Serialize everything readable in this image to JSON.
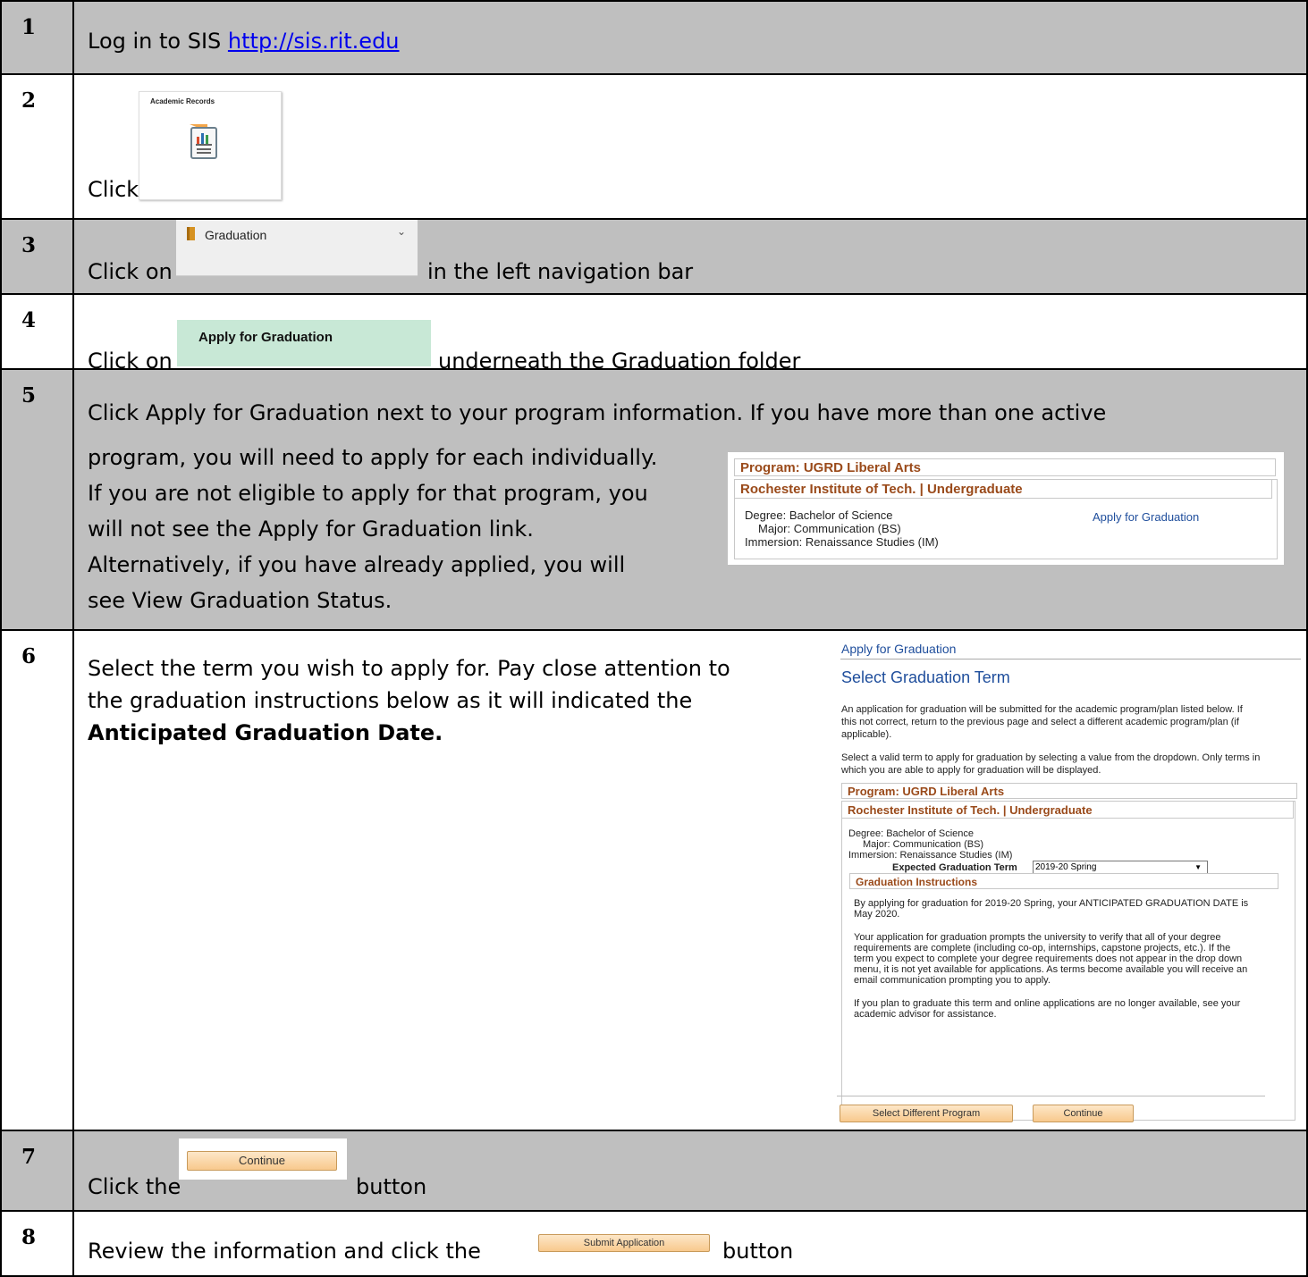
{
  "steps": {
    "s1": {
      "num": "1",
      "prefix": "Log in to SIS ",
      "link": "http://sis.rit.edu"
    },
    "s2": {
      "num": "2",
      "click": "Click",
      "tile_title": "Academic Records",
      "tile_icon": "report-chart-icon"
    },
    "s3": {
      "num": "3",
      "pre": "Click on",
      "nav_label": "Graduation",
      "post": "in the left navigation bar"
    },
    "s4": {
      "num": "4",
      "pre": "Click on",
      "button": "Apply for Graduation",
      "post": "underneath the Graduation folder"
    },
    "s5": {
      "num": "5",
      "line1": "Click Apply for Graduation next to your program information. If you have more than one active",
      "line2": "program, you will need to apply for each individually.",
      "line3": "If you are not eligible to apply for that program, you",
      "line4": "will not see the Apply for Graduation link.",
      "line5": "Alternatively, if you have already applied, you will",
      "line6": "see View Graduation Status.",
      "program": "Program: UGRD Liberal Arts",
      "institution": "Rochester Institute of Tech. | Undergraduate",
      "degree": "Degree: Bachelor of Science",
      "major": "Major: Communication (BS)",
      "immersion": "Immersion: Renaissance Studies (IM)",
      "apply_link": "Apply for Graduation"
    },
    "s6": {
      "num": "6",
      "line1": "Select the term you wish to apply for. Pay close attention to",
      "line2": "the graduation instructions below as it will indicated the",
      "line3": "Anticipated Graduation Date.",
      "page_title": "Apply for Graduation",
      "heading": "Select Graduation Term",
      "p1a": "An application for graduation will be submitted for the academic program/plan listed below. If",
      "p1b": "this not correct, return to the previous page and select a different academic program/plan (if",
      "p1c": "applicable).",
      "p2a": "Select a valid term to apply for graduation by selecting a value from the dropdown. Only terms in",
      "p2b": "which you are able to apply for graduation will be displayed.",
      "program": "Program: UGRD Liberal Arts",
      "institution": "Rochester Institute of Tech. | Undergraduate",
      "degree": "Degree: Bachelor of Science",
      "major": "Major: Communication (BS)",
      "immersion": "Immersion: Renaissance Studies (IM)",
      "term_label": "Expected Graduation Term",
      "term_value": "2019-20 Spring",
      "instr_head": "Graduation Instructions",
      "i1a": "By applying for graduation for 2019-20 Spring, your ANTICIPATED GRADUATION DATE is",
      "i1b": "May 2020.",
      "i2a": "Your application for graduation prompts the university to verify that all of your degree",
      "i2b": "requirements are complete (including co-op, internships, capstone projects, etc.).  If the",
      "i2c": "term you expect to complete your degree requirements does not appear in the drop down",
      "i2d": "menu, it is not yet available for applications.  As terms become available you will receive an",
      "i2e": "email communication prompting you to apply.",
      "i3a": "If you plan to graduate this term and online applications are no longer available, see your",
      "i3b": "academic advisor for assistance.",
      "btn_select": "Select Different Program",
      "btn_continue": "Continue"
    },
    "s7": {
      "num": "7",
      "pre": "Click the",
      "button": "Continue",
      "post": "button"
    },
    "s8": {
      "num": "8",
      "pre": "Review the information and click the",
      "button": "Submit Application",
      "post": "button"
    }
  },
  "colors": {
    "gray_row": "#bfbfbf",
    "heading_brown": "#9a4a1a",
    "link_blue": "#0000ee",
    "green_button": "#c8e8d6"
  }
}
